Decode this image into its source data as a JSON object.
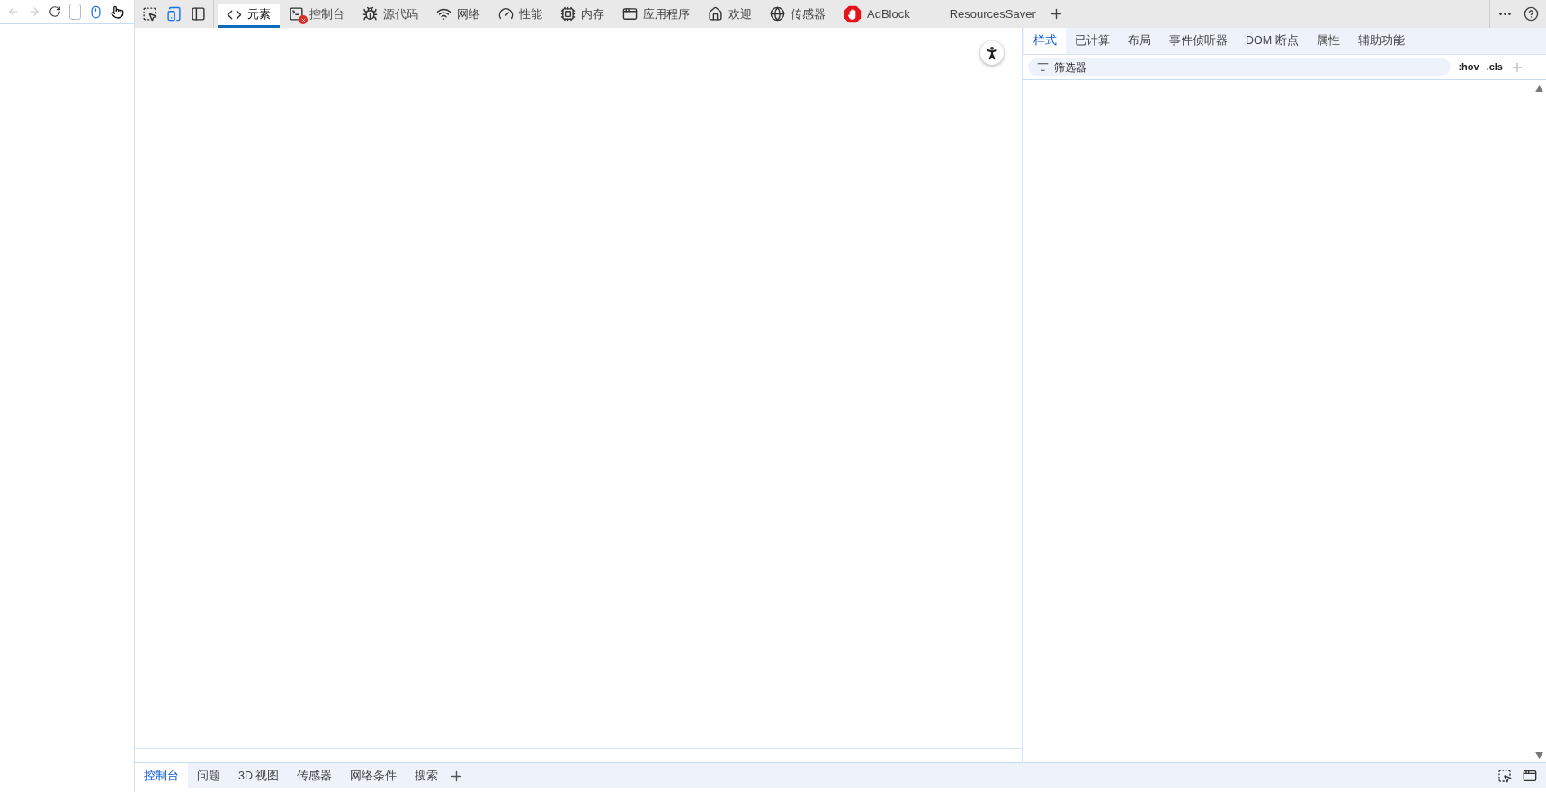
{
  "devtools_tabs": [
    {
      "label": "元素",
      "selected": true,
      "error_badge": false
    },
    {
      "label": "控制台",
      "selected": false,
      "error_badge": true
    },
    {
      "label": "源代码",
      "selected": false,
      "error_badge": false
    },
    {
      "label": "网络",
      "selected": false,
      "error_badge": false
    },
    {
      "label": "性能",
      "selected": false,
      "error_badge": false
    },
    {
      "label": "内存",
      "selected": false,
      "error_badge": false
    },
    {
      "label": "应用程序",
      "selected": false,
      "error_badge": false
    },
    {
      "label": "欢迎",
      "selected": false,
      "error_badge": false
    },
    {
      "label": "传感器",
      "selected": false,
      "error_badge": false
    },
    {
      "label": "AdBlock",
      "selected": false,
      "error_badge": false
    },
    {
      "label": "ResourcesSaver",
      "selected": false,
      "error_badge": false
    }
  ],
  "styles_tabs": [
    {
      "label": "样式",
      "selected": true
    },
    {
      "label": "已计算",
      "selected": false
    },
    {
      "label": "布局",
      "selected": false
    },
    {
      "label": "事件侦听器",
      "selected": false
    },
    {
      "label": "DOM 断点",
      "selected": false
    },
    {
      "label": "属性",
      "selected": false
    },
    {
      "label": "辅助功能",
      "selected": false
    }
  ],
  "filter": {
    "placeholder": "筛选器",
    "hov": ":hov",
    "cls": ".cls"
  },
  "drawer_tabs": [
    {
      "label": "控制台",
      "selected": true
    },
    {
      "label": "问题",
      "selected": false
    },
    {
      "label": "3D 视图",
      "selected": false
    },
    {
      "label": "传感器",
      "selected": false
    },
    {
      "label": "网络条件",
      "selected": false
    },
    {
      "label": "搜索",
      "selected": false
    }
  ]
}
